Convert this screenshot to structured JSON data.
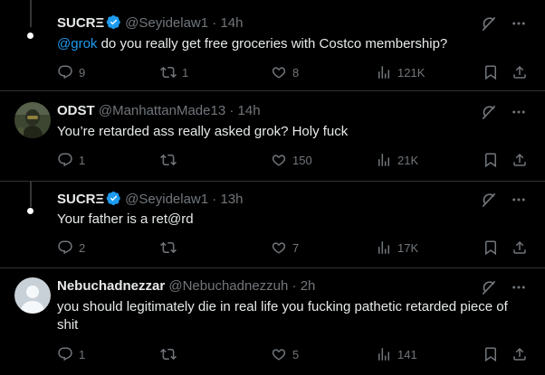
{
  "tweets": [
    {
      "name": "SUCRΞ",
      "handle": "@Seyidelaw1",
      "time": "· 14h",
      "mention": "@grok",
      "text": "do you really get free groceries with Costco membership?",
      "replies": "9",
      "retweets": "1",
      "likes": "8",
      "views": "121K"
    },
    {
      "name": "ODST",
      "handle": "@ManhattanMade13",
      "time": "· 14h",
      "text": "You’re retarded ass really asked grok? Holy fuck",
      "replies": "1",
      "retweets": "",
      "likes": "150",
      "views": "21K"
    },
    {
      "name": "SUCRΞ",
      "handle": "@Seyidelaw1",
      "time": "· 13h",
      "text": "Your father is a ret@rd",
      "replies": "2",
      "retweets": "",
      "likes": "7",
      "views": "17K"
    },
    {
      "name": "Nebuchadnezzar",
      "handle": "@Nebuchadnezzuh",
      "time": "· 2h",
      "text": "you should legitimately die in real life you fucking pathetic retarded piece of shit",
      "replies": "1",
      "retweets": "",
      "likes": "5",
      "views": "141"
    }
  ],
  "icons": {
    "more": "more-icon",
    "grok": "grok-icon",
    "reply": "reply-icon",
    "retweet": "retweet-icon",
    "like": "heart-icon",
    "views": "views-icon",
    "bookmark": "bookmark-icon",
    "share": "share-icon"
  },
  "colors": {
    "background": "#000000",
    "text": "#e7e9ea",
    "secondary": "#71767b",
    "accent": "#1d9bf0",
    "separator": "#2f3336"
  }
}
